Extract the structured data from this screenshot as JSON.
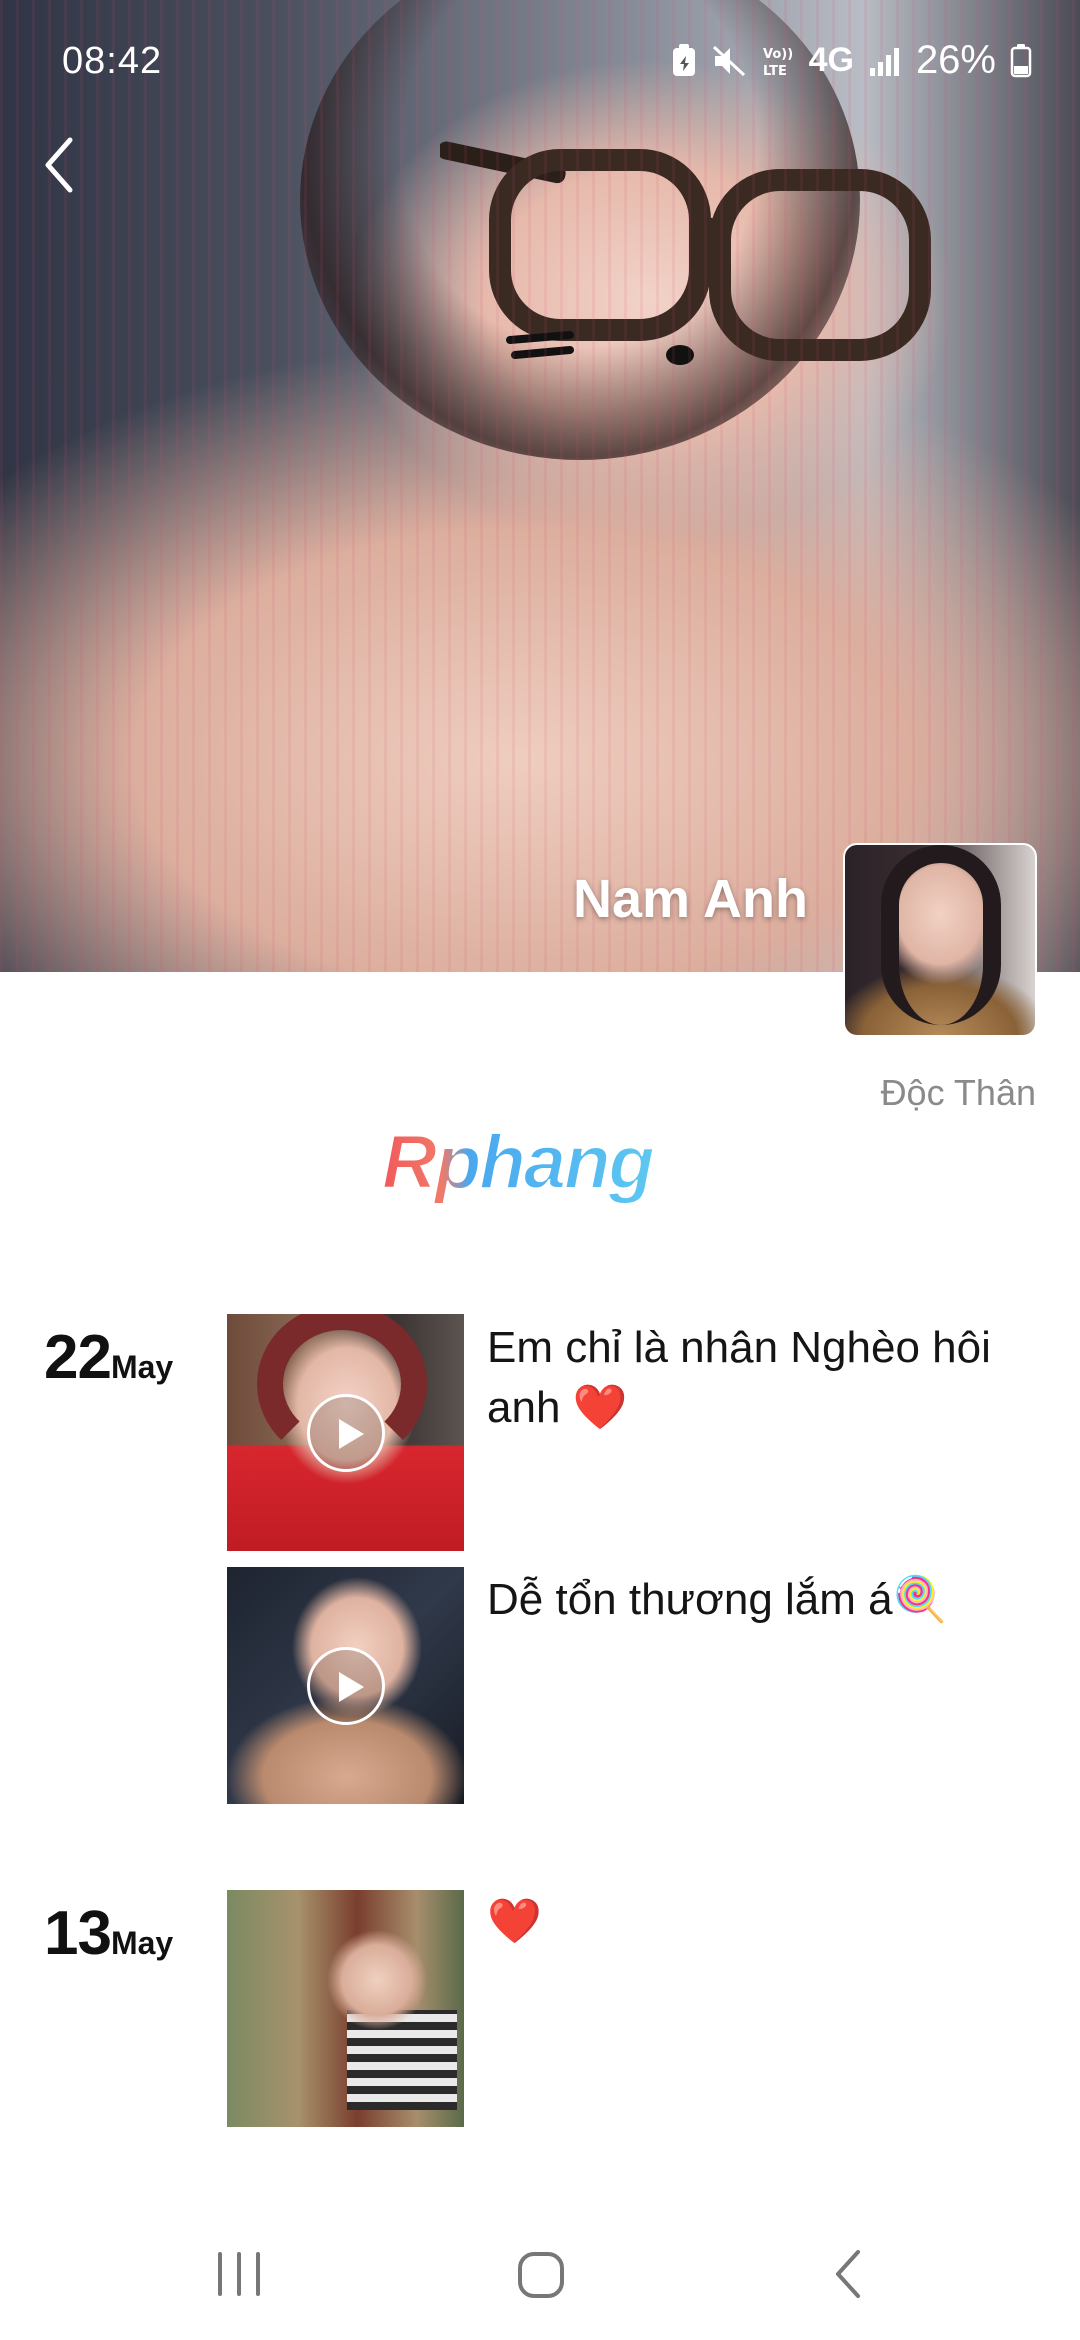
{
  "status_bar": {
    "time": "08:42",
    "network": "4G",
    "battery_percent": "26%"
  },
  "profile": {
    "name": "Nam Anh",
    "relationship": "Độc Thân",
    "logo_text": "Rphang"
  },
  "posts": [
    {
      "day": "22",
      "month": "May",
      "items": [
        {
          "caption": "Em chỉ là nhân Nghèo hôi anh ❤️",
          "media": "video"
        },
        {
          "caption": "Dễ tổn thương lắm á🍭",
          "media": "video"
        }
      ]
    },
    {
      "day": "13",
      "month": "May",
      "items": [
        {
          "caption": "❤️",
          "media": "photo"
        }
      ]
    }
  ],
  "icons": {
    "back": "chevron-left-icon",
    "play": "play-icon",
    "nav_recents": "recents-icon",
    "nav_home": "home-icon",
    "nav_back": "back-icon"
  },
  "colors": {
    "logo_red": "#f05a5a",
    "logo_blue": "#4aa8ef",
    "secondary_text": "#8a8a8a"
  }
}
